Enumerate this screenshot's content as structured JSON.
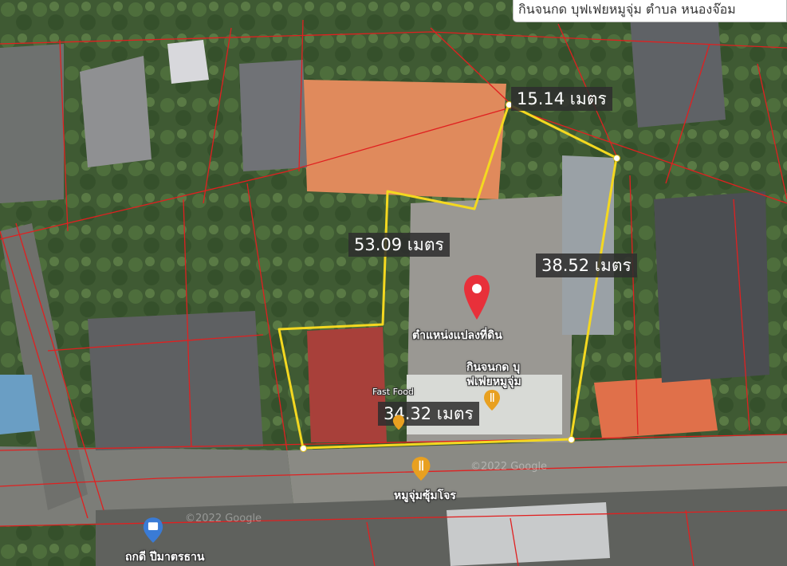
{
  "header": {
    "title": "กินจนกด บุฟเฟยหมูจุ่ม ตำบล หนองจ๊อม"
  },
  "measurements": [
    {
      "id": "top",
      "label": "15.14 เมตร"
    },
    {
      "id": "left",
      "label": "53.09 เมตร"
    },
    {
      "id": "right",
      "label": "38.52 เมตร"
    },
    {
      "id": "bottom",
      "label": "34.32 เมตร"
    }
  ],
  "marker": {
    "label": "ตำแหน่งแปลงที่ดิน",
    "color": "#e8303a",
    "icon": "map-pin-icon"
  },
  "pois": {
    "restaurant_1": "กินจนกด บุ",
    "restaurant_1b": "ฟเฟยหมูจุ่ม",
    "fast_food": "Fast Food",
    "restaurant_2": "หมูจุ่มซุ้มโจร",
    "bus_stop": "ถกดี ปีมาตรธาน"
  },
  "copyright": {
    "text_1": "©2022 Google",
    "text_2": "©2022 Google"
  },
  "colors": {
    "parcel_line": "#e02020",
    "boundary_line": "#f4d820",
    "poi_icon": "#e8a020",
    "bus_icon": "#3a7bd5"
  }
}
